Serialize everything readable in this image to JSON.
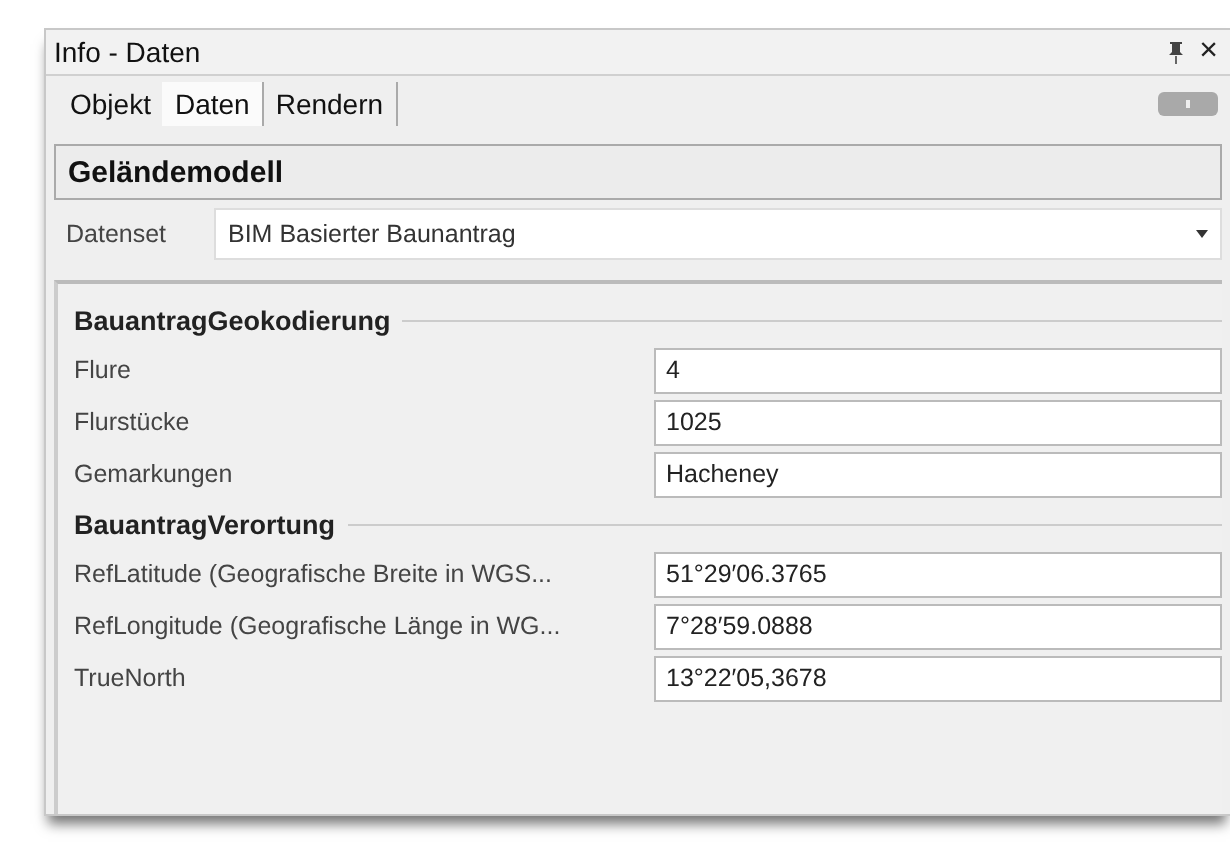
{
  "window": {
    "title": "Info - Daten",
    "close": "×"
  },
  "tabs": [
    {
      "label": "Objekt",
      "selected": false
    },
    {
      "label": "Daten",
      "selected": true
    },
    {
      "label": "Rendern",
      "selected": false
    }
  ],
  "header": "Geländemodell",
  "dataset": {
    "label": "Datenset",
    "value": "BIM Basierter Baunantrag"
  },
  "groups": [
    {
      "title": "BauantragGeokodierung",
      "rows": [
        {
          "label": "Flure",
          "value": "4"
        },
        {
          "label": "Flurstücke",
          "value": "1025"
        },
        {
          "label": "Gemarkungen",
          "value": "Hacheney"
        }
      ]
    },
    {
      "title": "BauantragVerortung",
      "rows": [
        {
          "label": "RefLatitude (Geografische Breite in WGS...",
          "value": "51°29′06.3765"
        },
        {
          "label": "RefLongitude (Geografische Länge in WG...",
          "value": "7°28′59.0888"
        },
        {
          "label": "TrueNorth",
          "value": "13°22′05,3678"
        }
      ]
    }
  ]
}
